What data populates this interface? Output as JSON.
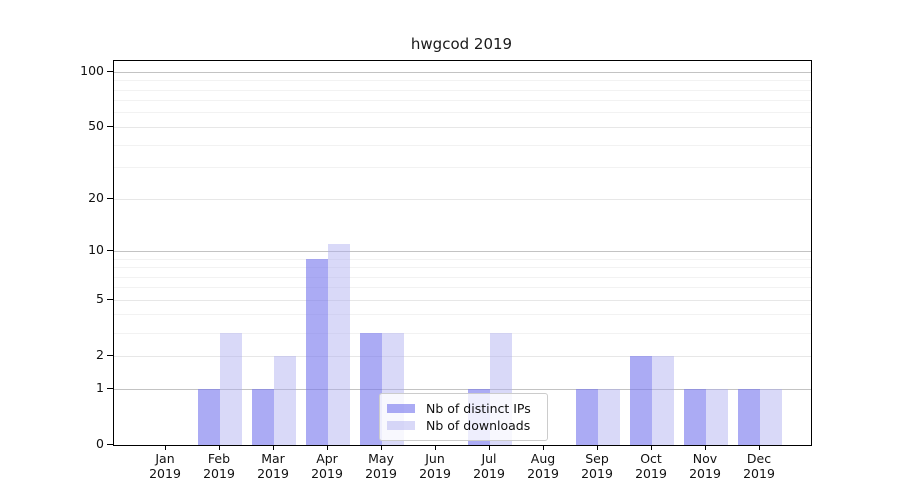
{
  "chart_data": {
    "type": "bar",
    "title": "hwgcod 2019",
    "categories": [
      "Jan 2019",
      "Feb 2019",
      "Mar 2019",
      "Apr 2019",
      "May 2019",
      "Jun 2019",
      "Jul 2019",
      "Aug 2019",
      "Sep 2019",
      "Oct 2019",
      "Nov 2019",
      "Dec 2019"
    ],
    "series": [
      {
        "name": "Nb of distinct IPs",
        "color": "rgba(119,119,238,0.62)",
        "hex_on_white": "#aaaaf3",
        "values": [
          0,
          1,
          1,
          9,
          3,
          0,
          1,
          0,
          1,
          2,
          1,
          1
        ]
      },
      {
        "name": "Nb of downloads",
        "color": "rgba(170,170,240,0.45)",
        "hex_on_white": "#d8d8f8",
        "values": [
          0,
          3,
          2,
          11,
          3,
          0,
          3,
          0,
          1,
          2,
          1,
          1
        ]
      }
    ],
    "xlabel": "",
    "ylabel": "",
    "yscale": "log10(1+x)",
    "yticks": [
      0,
      1,
      2,
      5,
      10,
      20,
      50,
      100
    ],
    "decade_gridline_values": [
      1,
      10,
      100
    ],
    "major_gridline_values": [
      2,
      5,
      20,
      50
    ],
    "minor_gridline_values": [
      3,
      4,
      6,
      7,
      8,
      9,
      30,
      40,
      60,
      70,
      80,
      90
    ],
    "ylim": [
      0,
      115
    ],
    "grid": true,
    "legend_position": "lower-center-inside"
  },
  "legend": {
    "items": [
      {
        "label": "Nb of distinct IPs"
      },
      {
        "label": "Nb of downloads"
      }
    ]
  },
  "colors": {
    "distinct_ips_bar": "#aaaaf3",
    "downloads_bar": "#d8d8f8",
    "spine": "#000000",
    "decade_grid": "#c3c3c3",
    "minor_grid": "#f2f2f2",
    "text": "#111111",
    "background": "#ffffff"
  }
}
